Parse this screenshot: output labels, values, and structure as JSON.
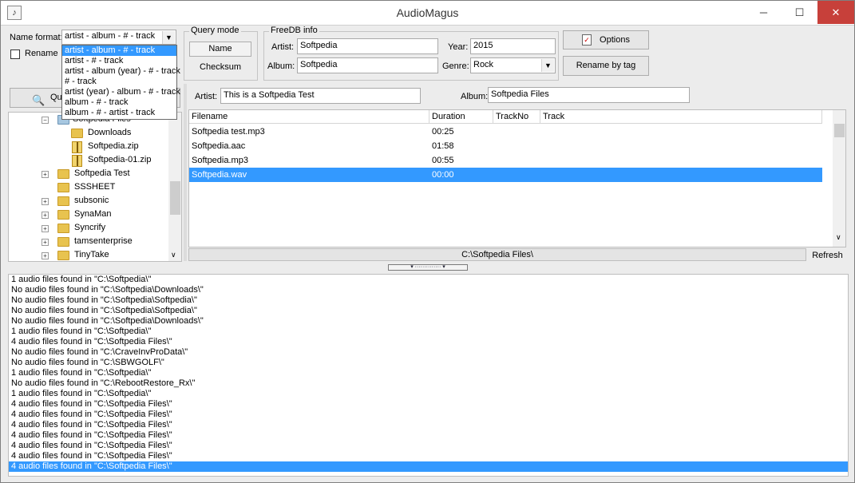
{
  "window": {
    "title": "AudioMagus",
    "icon": "audiomagus-app-icon",
    "controls": {
      "minimize": "─",
      "maximize": "☐",
      "close": "✕"
    }
  },
  "name_format": {
    "label": "Name format:",
    "value": "artist - album - # - track",
    "options": [
      "artist - album - # - track",
      "artist - # - track",
      "artist - album (year) - # - track",
      "# - track",
      "artist (year) - album  - # - track",
      "album - # - track",
      "album - # - artist - track"
    ],
    "selected_index": 0,
    "rename_checkbox_label": "Rename",
    "rename_checked": false
  },
  "query_mode": {
    "title": "Query mode",
    "name_button": "Name",
    "checksum_button": "Checksum"
  },
  "freedb": {
    "title": "FreeDB info",
    "artist_label": "Artist:",
    "artist_value": "Softpedia",
    "year_label": "Year:",
    "year_value": "2015",
    "album_label": "Album:",
    "album_value": "Softpedia",
    "genre_label": "Genre:",
    "genre_value": "Rock"
  },
  "buttons": {
    "options": "Options",
    "rename_by_tag": "Rename by tag",
    "query": "Qu",
    "refresh": "Refresh"
  },
  "tree": {
    "items": [
      {
        "label": "Softpedia Files",
        "icon": "folder-open-icon",
        "expander": "⊟"
      },
      {
        "label": "Downloads",
        "icon": "folder-icon",
        "expander": ""
      },
      {
        "label": "Softpedia.zip",
        "icon": "zip-icon",
        "expander": ""
      },
      {
        "label": "Softpedia-01.zip",
        "icon": "zip-icon",
        "expander": ""
      },
      {
        "label": "Softpedia Test",
        "icon": "folder-icon",
        "expander": "+"
      },
      {
        "label": "SSSHEET",
        "icon": "folder-icon",
        "expander": ""
      },
      {
        "label": "subsonic",
        "icon": "folder-icon",
        "expander": "+"
      },
      {
        "label": "SynaMan",
        "icon": "folder-icon",
        "expander": "+"
      },
      {
        "label": "Syncrify",
        "icon": "folder-icon",
        "expander": "+"
      },
      {
        "label": "tamsenterprise",
        "icon": "folder-icon",
        "expander": "+"
      },
      {
        "label": "TinyTake",
        "icon": "folder-icon",
        "expander": "+"
      }
    ]
  },
  "tag_bar": {
    "artist_label": "Artist:",
    "artist_value": "This is a Softpedia Test",
    "album_label": "Album:",
    "album_value": "Softpedia Files"
  },
  "file_list": {
    "columns": [
      "Filename",
      "Duration",
      "TrackNo",
      "Track"
    ],
    "rows": [
      {
        "filename": "Softpedia test.mp3",
        "duration": "00:25",
        "trackno": "",
        "track": ""
      },
      {
        "filename": "Softpedia.aac",
        "duration": "01:58",
        "trackno": "",
        "track": ""
      },
      {
        "filename": "Softpedia.mp3",
        "duration": "00:55",
        "trackno": "",
        "track": ""
      },
      {
        "filename": "Softpedia.wav",
        "duration": "00:00",
        "trackno": "",
        "track": ""
      }
    ],
    "selected_row": 3
  },
  "status_path": "C:\\Softpedia Files\\",
  "splitter_glyph": "▾ ·············· ▾",
  "log": {
    "lines": [
      "1 audio files found in \"C:\\Softpedia\\\"",
      "No audio files found in \"C:\\Softpedia\\Downloads\\\"",
      "No audio files found in \"C:\\Softpedia\\Softpedia\\\"",
      "No audio files found in \"C:\\Softpedia\\Softpedia\\\"",
      "No audio files found in \"C:\\Softpedia\\Downloads\\\"",
      "1 audio files found in \"C:\\Softpedia\\\"",
      "4 audio files found in \"C:\\Softpedia Files\\\"",
      "No audio files found in \"C:\\CraveInvProData\\\"",
      "No audio files found in \"C:\\SBWGOLF\\\"",
      "1 audio files found in \"C:\\Softpedia\\\"",
      "No audio files found in \"C:\\RebootRestore_Rx\\\"",
      "1 audio files found in \"C:\\Softpedia\\\"",
      "4 audio files found in \"C:\\Softpedia Files\\\"",
      "4 audio files found in \"C:\\Softpedia Files\\\"",
      "4 audio files found in \"C:\\Softpedia Files\\\"",
      "4 audio files found in \"C:\\Softpedia Files\\\"",
      "4 audio files found in \"C:\\Softpedia Files\\\"",
      "4 audio files found in \"C:\\Softpedia Files\\\"",
      "4 audio files found in \"C:\\Softpedia Files\\\""
    ],
    "selected_line": 18
  },
  "colors": {
    "selection": "#3399ff",
    "close_button": "#c7403a",
    "folder": "#e8c34f"
  }
}
